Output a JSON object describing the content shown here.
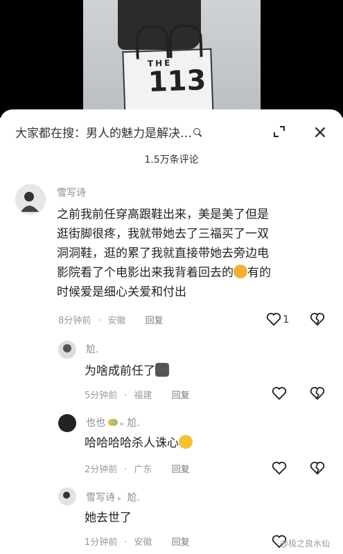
{
  "header": {
    "search_prefix": "大家都在搜：男人的魅力是解决…",
    "comment_count": "1.5万条评论"
  },
  "photo": {
    "bag_brand": "THE",
    "bag_number": "113"
  },
  "comments": [
    {
      "username": "雪写诗",
      "text_line1": "之前我前任穿高跟鞋出来，美是美了但是",
      "text_line2": "逛街脚很疼，我就带她去了三福买了一双",
      "text_line3": "洞洞鞋，逛的累了我就直接带她去旁边电",
      "text_line4a": "影院看了个电影出来我背着回去的",
      "text_line4b": "有的",
      "text_line5": "时候爱是细心关爱和付出",
      "time": "8分钟前",
      "location": "安徽",
      "reply": "回复",
      "likes": "1"
    },
    {
      "username": "尬.",
      "text": "为啥成前任了",
      "time": "5分钟前",
      "location": "福建",
      "reply": "回复"
    },
    {
      "username": "也也",
      "arrow": "▸",
      "reply_to": "尬.",
      "text": "哈哈哈哈杀人诛心",
      "time": "2分钟前",
      "location": "广东",
      "reply": "回复"
    },
    {
      "username": "雪写诗",
      "arrow": "▸",
      "reply_to": "尬.",
      "text": "她去世了",
      "time": "1分钟前",
      "location": "安徽",
      "reply": "回复"
    }
  ],
  "watermark": "@极之良水仙",
  "colors": {
    "text": "#222222",
    "meta": "#9a9a9a",
    "name": "#8a8a8a"
  }
}
